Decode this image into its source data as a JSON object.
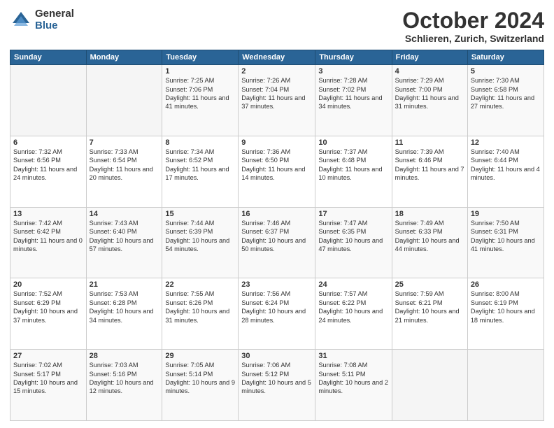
{
  "logo": {
    "general": "General",
    "blue": "Blue"
  },
  "header": {
    "month": "October 2024",
    "location": "Schlieren, Zurich, Switzerland"
  },
  "weekdays": [
    "Sunday",
    "Monday",
    "Tuesday",
    "Wednesday",
    "Thursday",
    "Friday",
    "Saturday"
  ],
  "weeks": [
    [
      {
        "day": "",
        "sunrise": "",
        "sunset": "",
        "daylight": ""
      },
      {
        "day": "",
        "sunrise": "",
        "sunset": "",
        "daylight": ""
      },
      {
        "day": "1",
        "sunrise": "Sunrise: 7:25 AM",
        "sunset": "Sunset: 7:06 PM",
        "daylight": "Daylight: 11 hours and 41 minutes."
      },
      {
        "day": "2",
        "sunrise": "Sunrise: 7:26 AM",
        "sunset": "Sunset: 7:04 PM",
        "daylight": "Daylight: 11 hours and 37 minutes."
      },
      {
        "day": "3",
        "sunrise": "Sunrise: 7:28 AM",
        "sunset": "Sunset: 7:02 PM",
        "daylight": "Daylight: 11 hours and 34 minutes."
      },
      {
        "day": "4",
        "sunrise": "Sunrise: 7:29 AM",
        "sunset": "Sunset: 7:00 PM",
        "daylight": "Daylight: 11 hours and 31 minutes."
      },
      {
        "day": "5",
        "sunrise": "Sunrise: 7:30 AM",
        "sunset": "Sunset: 6:58 PM",
        "daylight": "Daylight: 11 hours and 27 minutes."
      }
    ],
    [
      {
        "day": "6",
        "sunrise": "Sunrise: 7:32 AM",
        "sunset": "Sunset: 6:56 PM",
        "daylight": "Daylight: 11 hours and 24 minutes."
      },
      {
        "day": "7",
        "sunrise": "Sunrise: 7:33 AM",
        "sunset": "Sunset: 6:54 PM",
        "daylight": "Daylight: 11 hours and 20 minutes."
      },
      {
        "day": "8",
        "sunrise": "Sunrise: 7:34 AM",
        "sunset": "Sunset: 6:52 PM",
        "daylight": "Daylight: 11 hours and 17 minutes."
      },
      {
        "day": "9",
        "sunrise": "Sunrise: 7:36 AM",
        "sunset": "Sunset: 6:50 PM",
        "daylight": "Daylight: 11 hours and 14 minutes."
      },
      {
        "day": "10",
        "sunrise": "Sunrise: 7:37 AM",
        "sunset": "Sunset: 6:48 PM",
        "daylight": "Daylight: 11 hours and 10 minutes."
      },
      {
        "day": "11",
        "sunrise": "Sunrise: 7:39 AM",
        "sunset": "Sunset: 6:46 PM",
        "daylight": "Daylight: 11 hours and 7 minutes."
      },
      {
        "day": "12",
        "sunrise": "Sunrise: 7:40 AM",
        "sunset": "Sunset: 6:44 PM",
        "daylight": "Daylight: 11 hours and 4 minutes."
      }
    ],
    [
      {
        "day": "13",
        "sunrise": "Sunrise: 7:42 AM",
        "sunset": "Sunset: 6:42 PM",
        "daylight": "Daylight: 11 hours and 0 minutes."
      },
      {
        "day": "14",
        "sunrise": "Sunrise: 7:43 AM",
        "sunset": "Sunset: 6:40 PM",
        "daylight": "Daylight: 10 hours and 57 minutes."
      },
      {
        "day": "15",
        "sunrise": "Sunrise: 7:44 AM",
        "sunset": "Sunset: 6:39 PM",
        "daylight": "Daylight: 10 hours and 54 minutes."
      },
      {
        "day": "16",
        "sunrise": "Sunrise: 7:46 AM",
        "sunset": "Sunset: 6:37 PM",
        "daylight": "Daylight: 10 hours and 50 minutes."
      },
      {
        "day": "17",
        "sunrise": "Sunrise: 7:47 AM",
        "sunset": "Sunset: 6:35 PM",
        "daylight": "Daylight: 10 hours and 47 minutes."
      },
      {
        "day": "18",
        "sunrise": "Sunrise: 7:49 AM",
        "sunset": "Sunset: 6:33 PM",
        "daylight": "Daylight: 10 hours and 44 minutes."
      },
      {
        "day": "19",
        "sunrise": "Sunrise: 7:50 AM",
        "sunset": "Sunset: 6:31 PM",
        "daylight": "Daylight: 10 hours and 41 minutes."
      }
    ],
    [
      {
        "day": "20",
        "sunrise": "Sunrise: 7:52 AM",
        "sunset": "Sunset: 6:29 PM",
        "daylight": "Daylight: 10 hours and 37 minutes."
      },
      {
        "day": "21",
        "sunrise": "Sunrise: 7:53 AM",
        "sunset": "Sunset: 6:28 PM",
        "daylight": "Daylight: 10 hours and 34 minutes."
      },
      {
        "day": "22",
        "sunrise": "Sunrise: 7:55 AM",
        "sunset": "Sunset: 6:26 PM",
        "daylight": "Daylight: 10 hours and 31 minutes."
      },
      {
        "day": "23",
        "sunrise": "Sunrise: 7:56 AM",
        "sunset": "Sunset: 6:24 PM",
        "daylight": "Daylight: 10 hours and 28 minutes."
      },
      {
        "day": "24",
        "sunrise": "Sunrise: 7:57 AM",
        "sunset": "Sunset: 6:22 PM",
        "daylight": "Daylight: 10 hours and 24 minutes."
      },
      {
        "day": "25",
        "sunrise": "Sunrise: 7:59 AM",
        "sunset": "Sunset: 6:21 PM",
        "daylight": "Daylight: 10 hours and 21 minutes."
      },
      {
        "day": "26",
        "sunrise": "Sunrise: 8:00 AM",
        "sunset": "Sunset: 6:19 PM",
        "daylight": "Daylight: 10 hours and 18 minutes."
      }
    ],
    [
      {
        "day": "27",
        "sunrise": "Sunrise: 7:02 AM",
        "sunset": "Sunset: 5:17 PM",
        "daylight": "Daylight: 10 hours and 15 minutes."
      },
      {
        "day": "28",
        "sunrise": "Sunrise: 7:03 AM",
        "sunset": "Sunset: 5:16 PM",
        "daylight": "Daylight: 10 hours and 12 minutes."
      },
      {
        "day": "29",
        "sunrise": "Sunrise: 7:05 AM",
        "sunset": "Sunset: 5:14 PM",
        "daylight": "Daylight: 10 hours and 9 minutes."
      },
      {
        "day": "30",
        "sunrise": "Sunrise: 7:06 AM",
        "sunset": "Sunset: 5:12 PM",
        "daylight": "Daylight: 10 hours and 5 minutes."
      },
      {
        "day": "31",
        "sunrise": "Sunrise: 7:08 AM",
        "sunset": "Sunset: 5:11 PM",
        "daylight": "Daylight: 10 hours and 2 minutes."
      },
      {
        "day": "",
        "sunrise": "",
        "sunset": "",
        "daylight": ""
      },
      {
        "day": "",
        "sunrise": "",
        "sunset": "",
        "daylight": ""
      }
    ]
  ]
}
